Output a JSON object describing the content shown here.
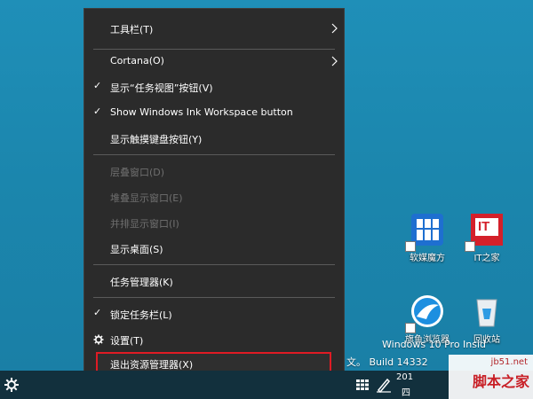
{
  "menu": {
    "items": [
      {
        "label": "工具栏(T)",
        "checked": false,
        "disabled": false,
        "submenu": true
      },
      {
        "label": "Cortana(O)",
        "checked": false,
        "disabled": false,
        "submenu": true
      },
      {
        "label": "显示“任务视图”按钮(V)",
        "checked": true,
        "disabled": false,
        "submenu": false
      },
      {
        "label": "Show Windows Ink Workspace button",
        "checked": true,
        "disabled": false,
        "submenu": false
      },
      {
        "label": "显示触摸键盘按钮(Y)",
        "checked": false,
        "disabled": false,
        "submenu": false
      },
      {
        "label": "层叠窗口(D)",
        "checked": false,
        "disabled": true,
        "submenu": false
      },
      {
        "label": "堆叠显示窗口(E)",
        "checked": false,
        "disabled": true,
        "submenu": false
      },
      {
        "label": "并排显示窗口(I)",
        "checked": false,
        "disabled": true,
        "submenu": false
      },
      {
        "label": "显示桌面(S)",
        "checked": false,
        "disabled": false,
        "submenu": false
      },
      {
        "label": "任务管理器(K)",
        "checked": false,
        "disabled": false,
        "submenu": false
      },
      {
        "label": "锁定任务栏(L)",
        "checked": true,
        "disabled": false,
        "submenu": false
      },
      {
        "label": "设置(T)",
        "checked": false,
        "disabled": false,
        "submenu": false,
        "icon": "gear-icon"
      },
      {
        "label": "退出资源管理器(X)",
        "checked": false,
        "disabled": false,
        "submenu": false,
        "highlighted": true
      }
    ],
    "check_glyph": "✓"
  },
  "desktop": {
    "icons": [
      {
        "caption": "软媒魔方",
        "icon": "app-cube-icon"
      },
      {
        "caption": "IT之家",
        "icon": "it-home-icon",
        "badge": "IT"
      },
      {
        "caption": "旗鱼浏览器",
        "icon": "sailfish-browser-icon"
      },
      {
        "caption": "回收站",
        "icon": "recycle-bin-icon"
      }
    ],
    "watermark": {
      "line1": "Windows 10 Pro Insid",
      "line2": "文。 Build 14332"
    }
  },
  "taskbar": {
    "clock_partial": "201",
    "date_partial": "四"
  },
  "site_logo": {
    "url": "jb51.net",
    "name": "脚本之家"
  },
  "colors": {
    "menu_bg": "#2b2b2b",
    "highlight_border": "#e01b24",
    "desktop_bg": "#1b86ad",
    "taskbar_bg": "#12303d"
  }
}
